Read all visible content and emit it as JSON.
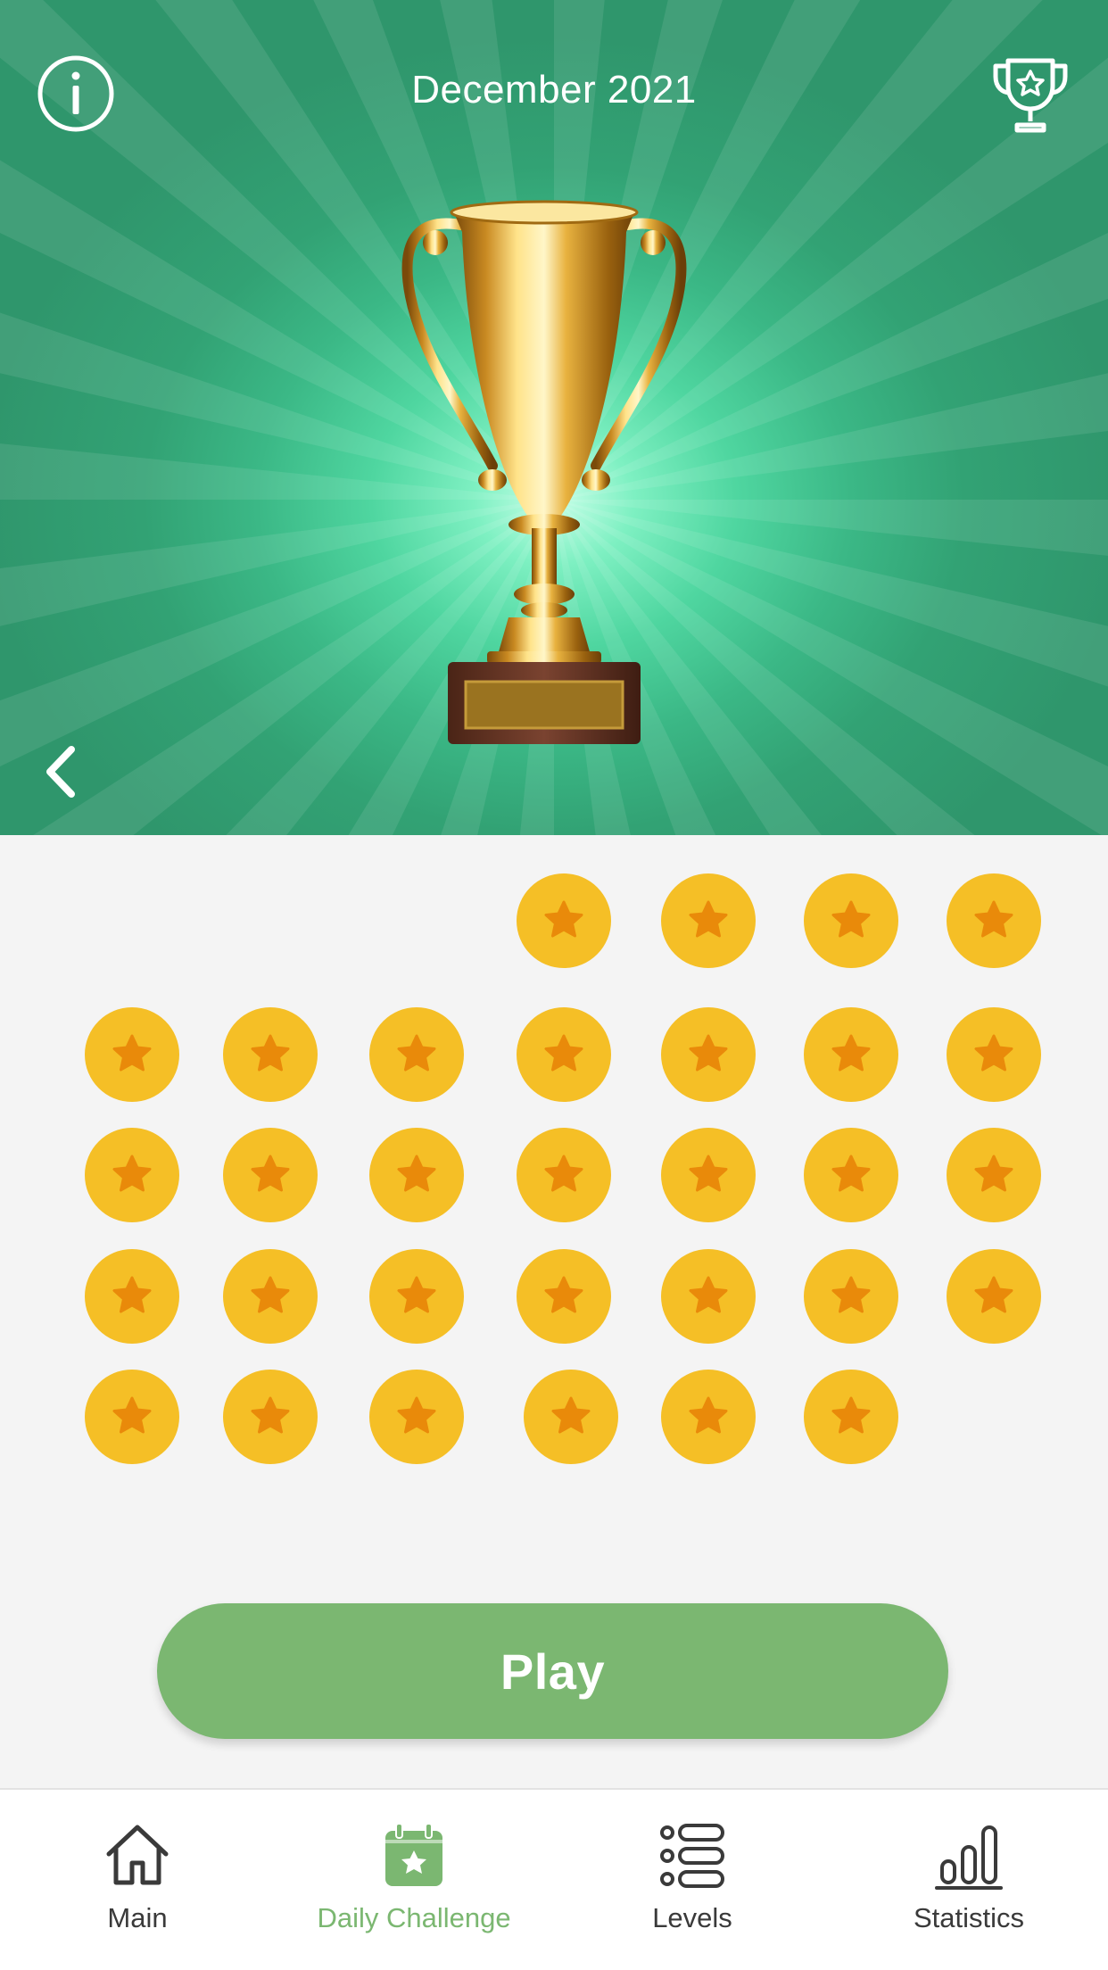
{
  "header": {
    "title": "December 2021"
  },
  "days": {
    "rows": [
      [
        false,
        false,
        false,
        true,
        true,
        true,
        true
      ],
      [
        true,
        true,
        true,
        true,
        true,
        true,
        true
      ],
      [
        true,
        true,
        true,
        true,
        true,
        true,
        true
      ],
      [
        true,
        true,
        true,
        true,
        true,
        true,
        true
      ],
      [
        true,
        true,
        true,
        true,
        true,
        true,
        false
      ]
    ],
    "completed_count": 31
  },
  "play_button": {
    "label": "Play"
  },
  "nav": {
    "items": [
      {
        "label": "Main",
        "icon": "home-icon"
      },
      {
        "label": "Daily Challenge",
        "icon": "calendar-star-icon",
        "active": true
      },
      {
        "label": "Levels",
        "icon": "list-icon"
      },
      {
        "label": "Statistics",
        "icon": "bar-chart-icon"
      }
    ]
  },
  "colors": {
    "hero_green": "#2f966c",
    "coin_gold": "#f5bf26",
    "coin_star": "#e98a0a",
    "accent_green": "#7bb771"
  }
}
